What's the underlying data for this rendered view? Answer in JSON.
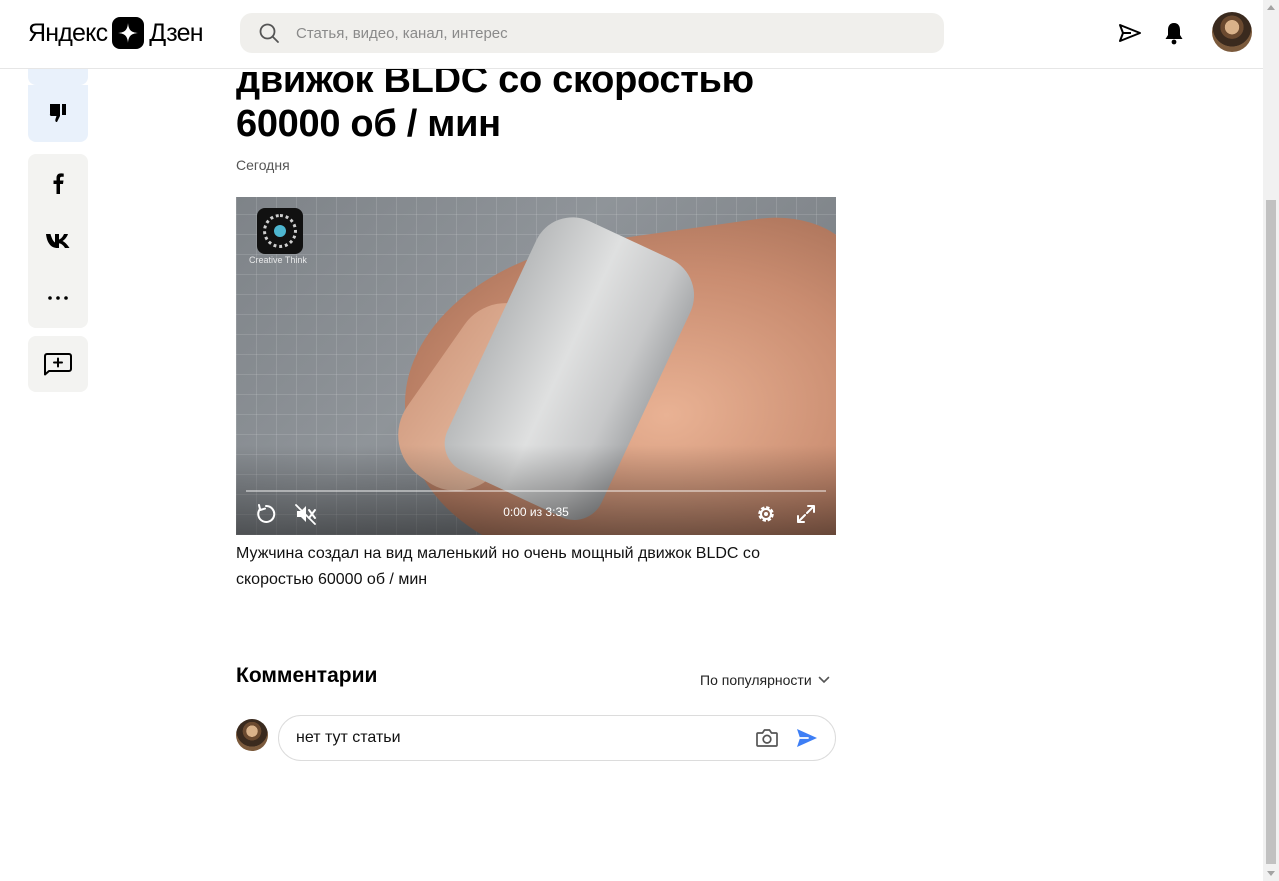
{
  "header": {
    "logo_left": "Яндекс",
    "logo_right": "Дзен",
    "search_placeholder": "Статья, видео, канал, интерес"
  },
  "article": {
    "title_line1": "движок BLDC со скоростью",
    "title_line2": "60000 об / мин",
    "date": "Сегодня",
    "caption": "Мужчина создал на вид маленький но очень мощный движок BLDC со скоростью 60000 об / мин"
  },
  "video": {
    "channel_watermark": "Creative Think",
    "time": "0:00 из 3:35",
    "progress": 0
  },
  "comments": {
    "heading": "Комментарии",
    "sort_label": "По популярности",
    "input_value": "нет тут статьи"
  },
  "icons": {
    "send": "paper-plane-icon",
    "notifications": "bell-icon",
    "dislike": "thumb-down-icon",
    "share_fb": "facebook-icon",
    "share_vk": "vk-icon",
    "more": "more-icon",
    "add_comment": "add-comment-icon",
    "replay": "replay-icon",
    "mute": "mute-icon",
    "settings": "gear-icon",
    "fullscreen": "fullscreen-icon",
    "camera": "camera-icon"
  },
  "colors": {
    "accent": "#3d7ef5",
    "reaction_bg": "#e9f1fb",
    "panel_bg": "#f3f3f1"
  }
}
